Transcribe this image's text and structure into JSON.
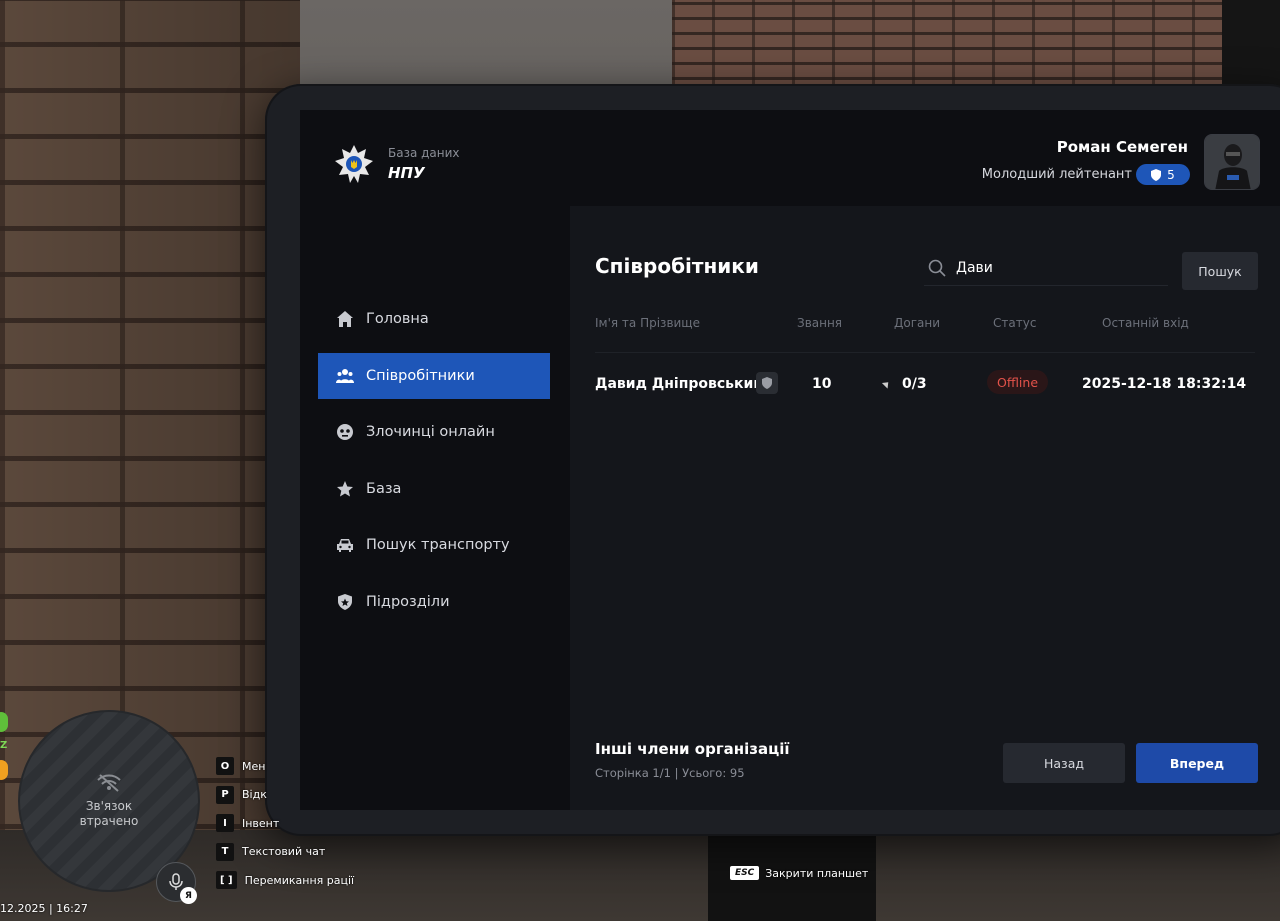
{
  "brand": {
    "subtitle": "База даних",
    "title": "НПУ"
  },
  "user": {
    "name": "Роман Семеген",
    "rank": "Молодший лейтенант",
    "badge_count": "5"
  },
  "nav": {
    "items": [
      {
        "label": "Головна",
        "icon": "home-icon"
      },
      {
        "label": "Співробітники",
        "icon": "people-icon",
        "active": true
      },
      {
        "label": "Злочинці онлайн",
        "icon": "mask-icon"
      },
      {
        "label": "База",
        "icon": "star-icon"
      },
      {
        "label": "Пошук транспорту",
        "icon": "car-icon"
      },
      {
        "label": "Підрозділи",
        "icon": "shield-icon"
      }
    ]
  },
  "main": {
    "title": "Співробітники",
    "search": {
      "value": "Дави",
      "button": "Пошук"
    },
    "columns": [
      "Ім'я та Прізвище",
      "Звання",
      "Догани",
      "Статус",
      "Останній вхід"
    ],
    "rows": [
      {
        "name": "Давид Дніпровський",
        "rank": "10",
        "reprimands": "0/3",
        "status": "Offline",
        "last_login": "2025-12-18 18:32:14"
      }
    ],
    "footer": {
      "title": "Інші члени організації",
      "meta": "Сторінка 1/1 | Усього: 95",
      "back": "Назад",
      "next": "Вперед"
    }
  },
  "hud": {
    "minimap_line1": "Зв'язок",
    "minimap_line2": "втрачено",
    "mic_lang": "Я",
    "z_label": "Z",
    "datetime": "12.2025 | 16:27",
    "keys": [
      {
        "key": "O",
        "label": "Мен"
      },
      {
        "key": "P",
        "label": "Відк"
      },
      {
        "key": "I",
        "label": "Інвент"
      },
      {
        "key": "T",
        "label": "Текстовий чат"
      },
      {
        "key": "[   ]",
        "label": "Перемикання рації"
      }
    ],
    "esc": {
      "key": "ESC",
      "label": "Закрити планшет"
    }
  },
  "colors": {
    "accent": "#1e56b8",
    "offline": "#e2524a",
    "panel": "#14161b",
    "screen": "#0d0e12"
  }
}
